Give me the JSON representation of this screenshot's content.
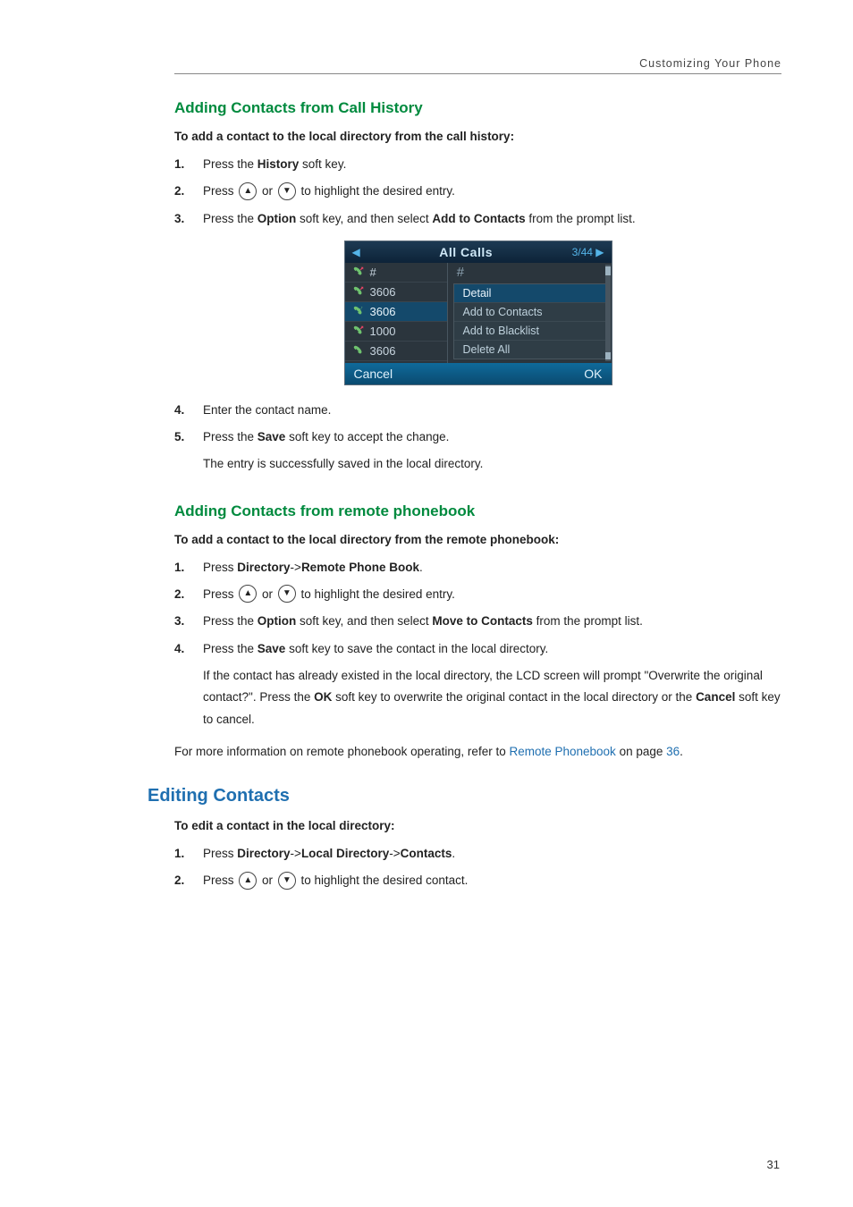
{
  "header": {
    "text": "Customizing Your Phone"
  },
  "section1": {
    "heading": "Adding Contacts from Call History",
    "subhead": "To add a contact to the local directory from the call history:",
    "steps": [
      {
        "num": "1.",
        "prefix": "Press the ",
        "b1": "History",
        "suffix": " soft key."
      },
      {
        "num": "2.",
        "prefix": "Press ",
        "mid": " or ",
        "suffix": " to highlight the desired entry."
      },
      {
        "num": "3.",
        "prefix": "Press the ",
        "b1": "Option",
        "mid": " soft key, and then select ",
        "b2": "Add to Contacts",
        "suffix": " from the prompt list."
      },
      {
        "num": "4.",
        "text": "Enter the contact name."
      },
      {
        "num": "5.",
        "prefix": "Press the ",
        "b1": "Save",
        "suffix": " soft key to accept the change.",
        "follow": "The entry is successfully saved in the local directory."
      }
    ]
  },
  "phone": {
    "topTitle": "All Calls",
    "topPage": "3/44",
    "leftRows": [
      {
        "label": "#",
        "type": "out"
      },
      {
        "label": "3606",
        "type": "out"
      },
      {
        "label": "3606",
        "type": "in",
        "selected": true
      },
      {
        "label": "1000",
        "type": "out"
      },
      {
        "label": "3606",
        "type": "in"
      }
    ],
    "hash": "#",
    "menu": [
      {
        "label": "Detail",
        "selected": true
      },
      {
        "label": "Add to Contacts"
      },
      {
        "label": "Add to Blacklist"
      },
      {
        "label": "Delete All"
      }
    ],
    "bottomLeft": "Cancel",
    "bottomRight": "OK"
  },
  "section2": {
    "heading": "Adding Contacts from remote phonebook",
    "subhead": "To add a contact to the local directory from the remote phonebook:",
    "steps": [
      {
        "num": "1.",
        "prefix": "Press ",
        "b1": "Directory",
        "mid1": "->",
        "b2": "Remote Phone Book",
        "suffix": "."
      },
      {
        "num": "2.",
        "prefix": "Press ",
        "mid": " or ",
        "suffix": " to highlight the desired entry."
      },
      {
        "num": "3.",
        "prefix": "Press the ",
        "b1": "Option",
        "mid": " soft key, and then select ",
        "b2": "Move to Contacts",
        "suffix": " from the prompt list."
      },
      {
        "num": "4.",
        "prefix": "Press the ",
        "b1": "Save",
        "suffix": " soft key to save the contact in the local directory.",
        "follow_pre": "If the contact has already existed in the local directory, the LCD screen will prompt \"Overwrite the original contact?\". Press the ",
        "follow_b1": "OK",
        "follow_mid": " soft key to overwrite the original contact in the local directory or the ",
        "follow_b2": "Cancel",
        "follow_suf": " soft key to cancel."
      }
    ],
    "para_pre": "For more information on remote phonebook operating, refer to ",
    "para_link": "Remote Phonebook",
    "para_mid": " on page ",
    "para_page": "36",
    "para_suf": "."
  },
  "section3": {
    "heading": "Editing Contacts",
    "subhead": "To edit a contact in the local directory:",
    "steps": [
      {
        "num": "1.",
        "prefix": "Press ",
        "b1": "Directory",
        "mid1": "->",
        "b2": "Local Directory",
        "mid2": "->",
        "b3": "Contacts",
        "suffix": "."
      },
      {
        "num": "2.",
        "prefix": "Press ",
        "mid": " or ",
        "suffix": " to highlight the desired contact."
      }
    ]
  },
  "pageNumber": "31"
}
